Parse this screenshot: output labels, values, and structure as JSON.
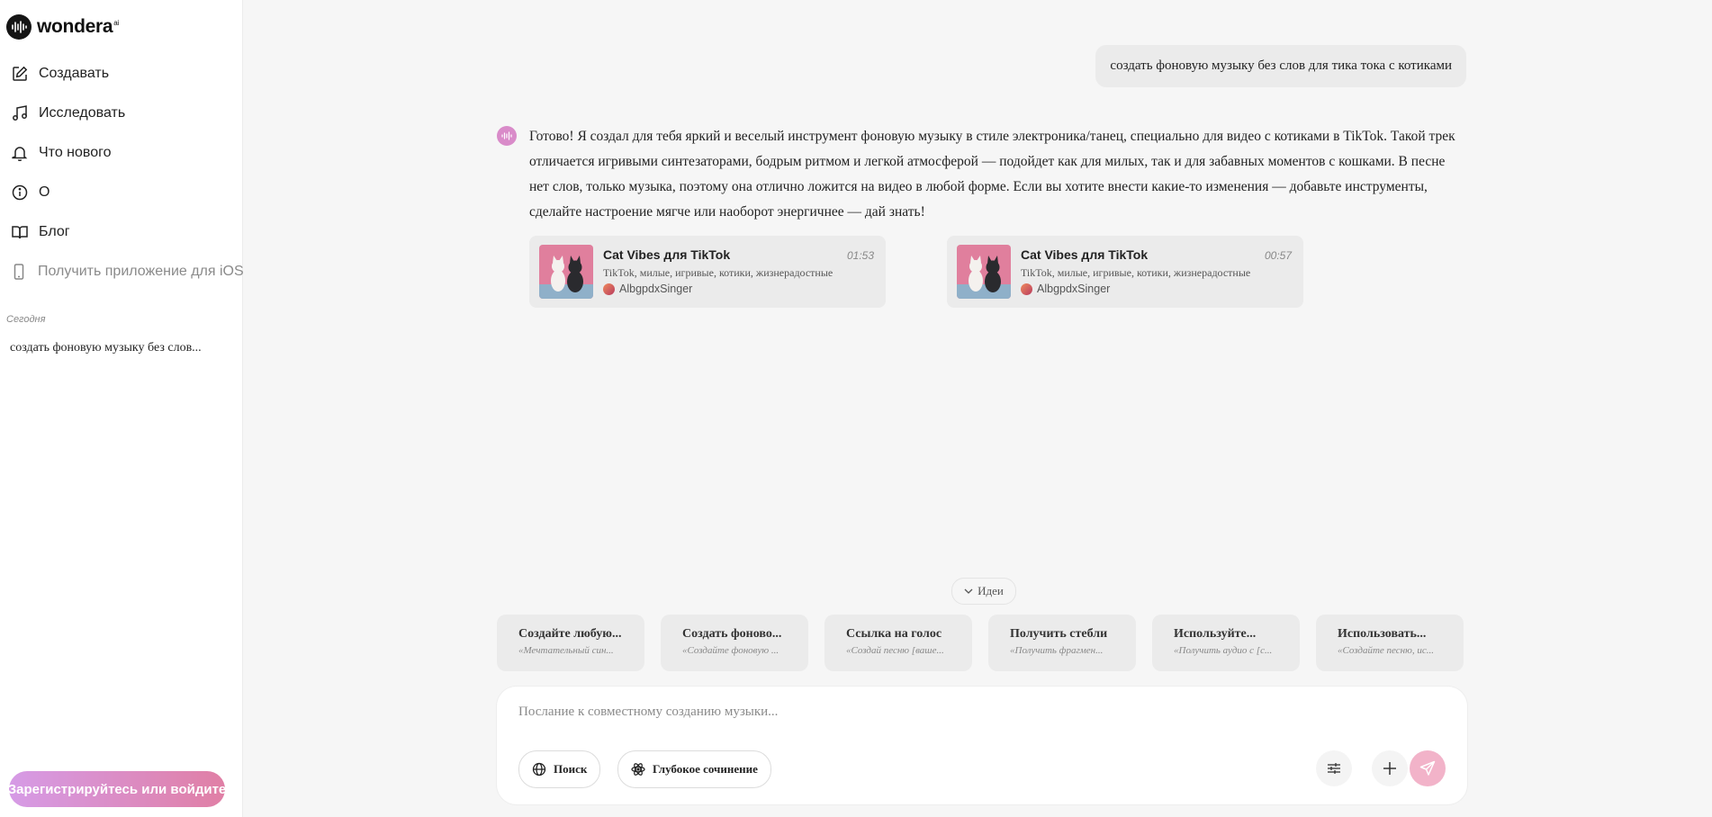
{
  "app": {
    "name": "wondera",
    "superscript": "ai"
  },
  "sidebar": {
    "items": [
      {
        "label": "Создавать",
        "icon": "edit-icon"
      },
      {
        "label": "Исследовать",
        "icon": "music-note-icon"
      },
      {
        "label": "Что нового",
        "icon": "bell-icon"
      },
      {
        "label": "О",
        "icon": "info-icon"
      },
      {
        "label": "Блог",
        "icon": "book-icon"
      },
      {
        "label": "Получить приложение для iOS",
        "icon": "phone-icon"
      }
    ],
    "history_label": "Сегодня",
    "history": [
      "создать фоновую музыку без слов..."
    ],
    "signup_label": "Зарегистрируйтесь или войдите"
  },
  "chat": {
    "user_message": "создать фоновую музыку без слов для тика тока с котиками",
    "assistant_message": "Готово! Я создал для тебя яркий и веселый инструмент фоновую музыку в стиле электроника/танец, специально для видео с котиками в TikTok. Такой трек отличается игривыми синтезаторами, бодрым ритмом и легкой атмосферой — подойдет как для милых, так и для забавных моментов с кошками. В песне нет слов, только музыка, поэтому она отлично ложится на видео в любой форме. Если вы хотите внести какие-то изменения — добавьте инструменты, сделайте настроение мягче или наоборот энергичнее — дай знать!",
    "tracks": [
      {
        "title": "Cat Vibes для TikTok",
        "duration": "01:53",
        "tags": "TikTok, милые, игривые, котики, жизнерадостные",
        "artist": "AlbgpdxSinger"
      },
      {
        "title": "Cat Vibes для TikTok",
        "duration": "00:57",
        "tags": "TikTok, милые, игривые, котики, жизнерадостные",
        "artist": "AlbgpdxSinger"
      }
    ]
  },
  "ideas": {
    "toggle_label": "Идеи",
    "items": [
      {
        "title": "Создайте любую...",
        "subtitle": "«Мечтательный син..."
      },
      {
        "title": "Создать фоново...",
        "subtitle": "«Создайте фоновую ..."
      },
      {
        "title": "Ссылка на голос",
        "subtitle": "«Создай песню [ваше..."
      },
      {
        "title": "Получить стебли",
        "subtitle": "«Получить фрагмен..."
      },
      {
        "title": "Используйте...",
        "subtitle": "«Получить аудио с [с..."
      },
      {
        "title": "Использовать...",
        "subtitle": "«Создайте песню, ис..."
      }
    ]
  },
  "composer": {
    "placeholder": "Послание к совместному созданию музыки...",
    "search_label": "Поиск",
    "deep_label": "Глубокое сочинение"
  },
  "colors": {
    "accent": "#e07fa5",
    "accent_light": "#f2b3c9",
    "card_bg": "#ebebeb",
    "page_bg": "#f6f6f6"
  }
}
